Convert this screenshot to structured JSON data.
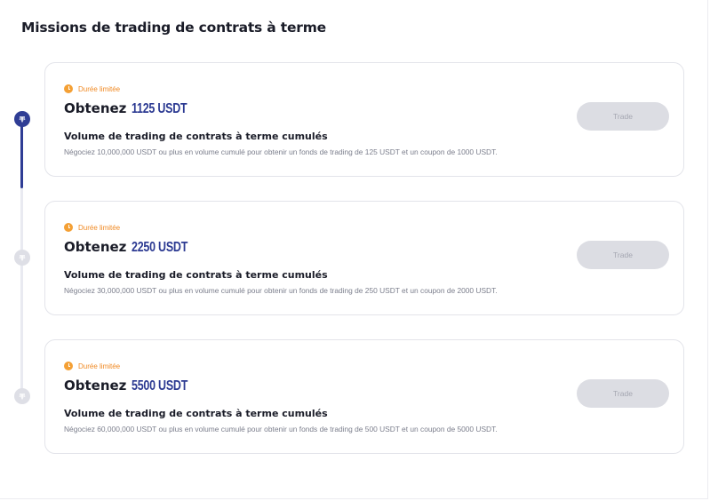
{
  "section": {
    "title": "Missions de trading de contrats à terme"
  },
  "timeline": {
    "progress_fraction": 0.25
  },
  "missions": [
    {
      "tag": "Durée limitée",
      "reward_prefix": "Obtenez",
      "reward_amount": "1125 USDT",
      "title": "Volume de trading de contrats à terme cumulés",
      "description": "Négociez 10,000,000 USDT ou plus en volume cumulé pour obtenir un fonds de trading de 125 USDT et un coupon de 1000 USDT.",
      "button_label": "Trade",
      "status": "active"
    },
    {
      "tag": "Durée limitée",
      "reward_prefix": "Obtenez",
      "reward_amount": "2250 USDT",
      "title": "Volume de trading de contrats à terme cumulés",
      "description": "Négociez 30,000,000 USDT ou plus en volume cumulé pour obtenir un fonds de trading de 250 USDT et un coupon de 2000 USDT.",
      "button_label": "Trade",
      "status": "inactive"
    },
    {
      "tag": "Durée limitée",
      "reward_prefix": "Obtenez",
      "reward_amount": "5500 USDT",
      "title": "Volume de trading de contrats à terme cumulés",
      "description": "Négociez 60,000,000 USDT ou plus en volume cumulé pour obtenir un fonds de trading de 500 USDT et un coupon de 5000 USDT.",
      "button_label": "Trade",
      "status": "inactive"
    }
  ],
  "colors": {
    "accent": "#2c3a92",
    "tag": "#f08a24",
    "button_disabled": "#dcdde3",
    "timeline_inactive": "#dedfe6"
  },
  "icons": {
    "tag_icon": "clock-icon",
    "node_icon": "tether-icon"
  }
}
